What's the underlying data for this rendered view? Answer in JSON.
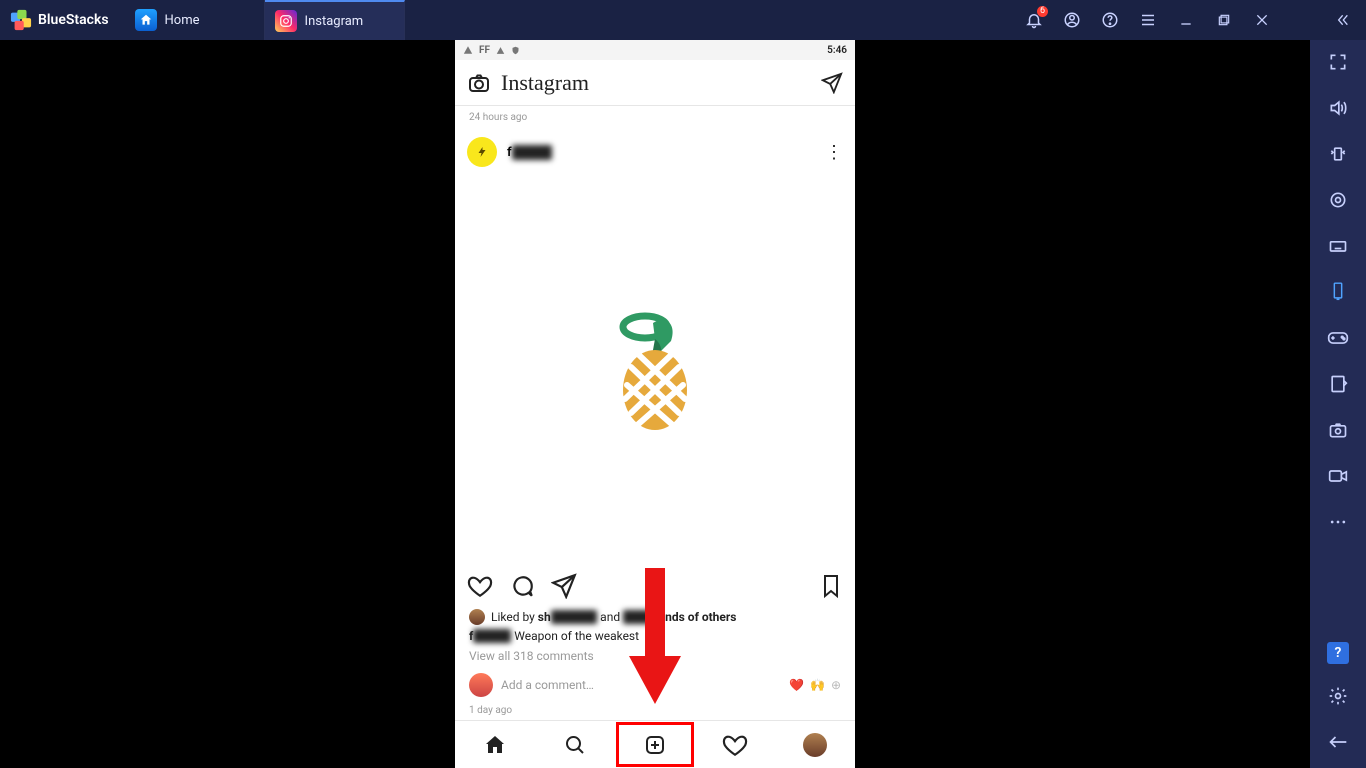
{
  "app_title": "BlueStacks",
  "tabs": [
    {
      "label": "Home"
    },
    {
      "label": "Instagram"
    }
  ],
  "notification_count": "6",
  "status_bar": {
    "time": "5:46"
  },
  "instagram": {
    "logo_text": "Instagram",
    "previous_post_time": "24 hours ago",
    "post": {
      "username_prefix": "f",
      "username_hidden": "████",
      "liked_by_prefix": "Liked by ",
      "liked_by_bold_prefix": "sh",
      "liked_by_hidden_mid": "█████",
      "liked_by_and": " and ",
      "liked_by_hidden_mid2": "███",
      "liked_by_suffix": "sands of others",
      "caption_user_prefix": "f",
      "caption_user_hidden": "████",
      "caption_text": " Weapon of the weakest",
      "view_comments": "View all 318 comments",
      "add_comment_placeholder": "Add a comment…",
      "post_time": "1 day ago"
    },
    "quick_reacts": {
      "heart": "❤️",
      "hands": "🙌",
      "plus": "⊕"
    }
  }
}
